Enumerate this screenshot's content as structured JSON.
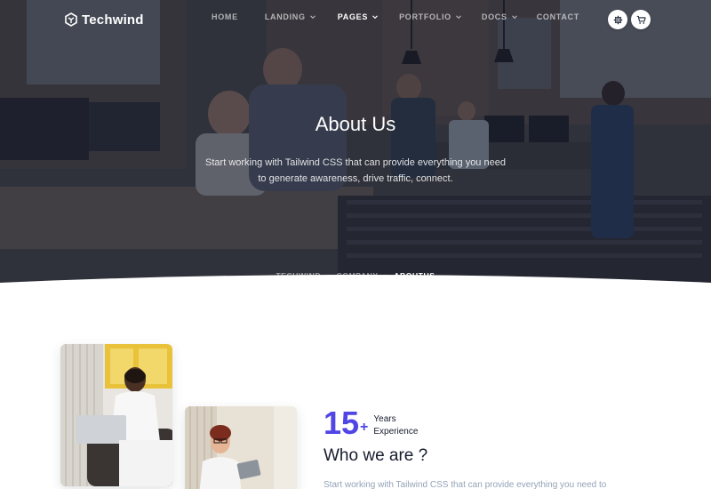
{
  "brand": {
    "name": "Techwind"
  },
  "nav": {
    "items": [
      {
        "label": "HOME",
        "dropdown": false,
        "active": false
      },
      {
        "label": "LANDING",
        "dropdown": true,
        "active": false
      },
      {
        "label": "PAGES",
        "dropdown": true,
        "active": true
      },
      {
        "label": "PORTFOLIO",
        "dropdown": true,
        "active": false
      },
      {
        "label": "DOCS",
        "dropdown": true,
        "active": false
      },
      {
        "label": "CONTACT",
        "dropdown": false,
        "active": false
      }
    ],
    "buttons": [
      {
        "icon": "settings-icon"
      },
      {
        "icon": "cart-icon"
      }
    ]
  },
  "hero": {
    "title": "About Us",
    "subtitle": "Start working with Tailwind CSS that can provide everything you need to generate awareness, drive traffic, connect.",
    "breadcrumb": [
      "TECHWIND",
      "COMPANY",
      "ABOUTUS"
    ]
  },
  "about": {
    "stat_number": "15",
    "stat_suffix": "+",
    "stat_label_line1": "Years",
    "stat_label_line2": "Experience",
    "heading": "Who we are ?",
    "text": "Start working with Tailwind CSS that can provide everything you need to"
  },
  "colors": {
    "accent": "#4f46e5",
    "heading": "#161c2d",
    "muted": "#94a3b8",
    "overlay": "#161c2d"
  }
}
